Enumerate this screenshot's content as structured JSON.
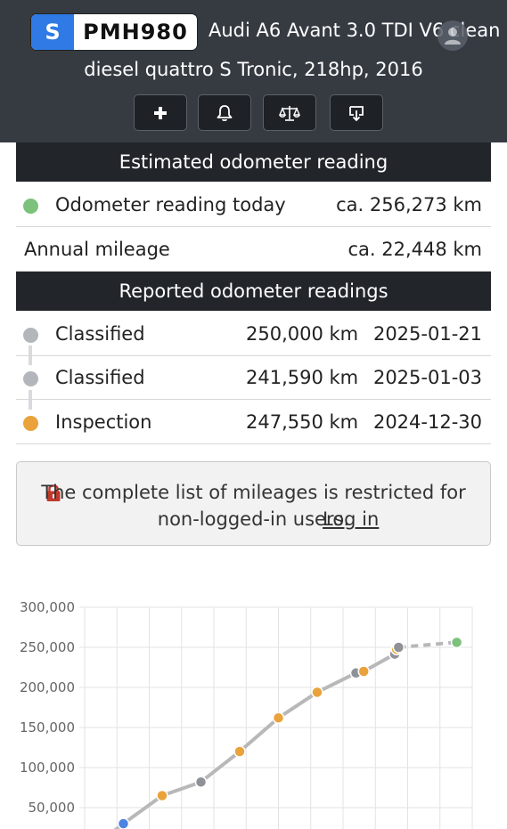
{
  "header": {
    "plate": {
      "country": "S",
      "number": "PMH980"
    },
    "title_line1": "Audi A6 Avant 3.0 TDI V6 clean",
    "title_line2": "diesel quattro S Tronic, 218hp, 2016",
    "toolbar": [
      {
        "name": "add-button",
        "icon": "plus-icon"
      },
      {
        "name": "alert-button",
        "icon": "bell-icon"
      },
      {
        "name": "compare-button",
        "icon": "scale-icon"
      },
      {
        "name": "download-button",
        "icon": "download-icon"
      }
    ]
  },
  "estimated": {
    "heading": "Estimated odometer reading",
    "today_label": "Odometer reading today",
    "today_value": "ca. 256,273 km",
    "annual_label": "Annual mileage",
    "annual_value": "ca. 22,448 km"
  },
  "reported": {
    "heading": "Reported odometer readings",
    "rows": [
      {
        "source": "Classified",
        "km": "250,000 km",
        "date": "2025-01-21",
        "color": "#b3b6bb"
      },
      {
        "source": "Classified",
        "km": "241,590 km",
        "date": "2025-01-03",
        "color": "#b3b6bb"
      },
      {
        "source": "Inspection",
        "km": "247,550 km",
        "date": "2024-12-30",
        "color": "#eaa23a"
      }
    ]
  },
  "notice": {
    "text": "The complete list of mileages is restricted for non-logged-in users.",
    "link": "Log in"
  },
  "colors": {
    "today_dot": "#7cc27c",
    "inspection": "#eaa23a",
    "classified": "#8e9196",
    "first": "#4c84e0"
  },
  "chart_data": {
    "type": "line",
    "y_ticks": [
      "300,000",
      "250,000",
      "200,000",
      "150,000",
      "100,000",
      "50,000"
    ],
    "ylim": [
      0,
      300000
    ],
    "grid": true,
    "points": [
      {
        "x": 1,
        "y": 30000,
        "kind": "first"
      },
      {
        "x": 2,
        "y": 65000,
        "kind": "inspection"
      },
      {
        "x": 3,
        "y": 82000,
        "kind": "classified"
      },
      {
        "x": 4,
        "y": 120000,
        "kind": "inspection"
      },
      {
        "x": 5,
        "y": 162000,
        "kind": "inspection"
      },
      {
        "x": 6,
        "y": 194000,
        "kind": "inspection"
      },
      {
        "x": 7,
        "y": 218000,
        "kind": "classified"
      },
      {
        "x": 7.2,
        "y": 220000,
        "kind": "inspection"
      },
      {
        "x": 8,
        "y": 241590,
        "kind": "classified"
      },
      {
        "x": 8.05,
        "y": 247550,
        "kind": "inspection"
      },
      {
        "x": 8.1,
        "y": 250000,
        "kind": "classified"
      },
      {
        "x": 9.6,
        "y": 256273,
        "kind": "today"
      }
    ]
  }
}
